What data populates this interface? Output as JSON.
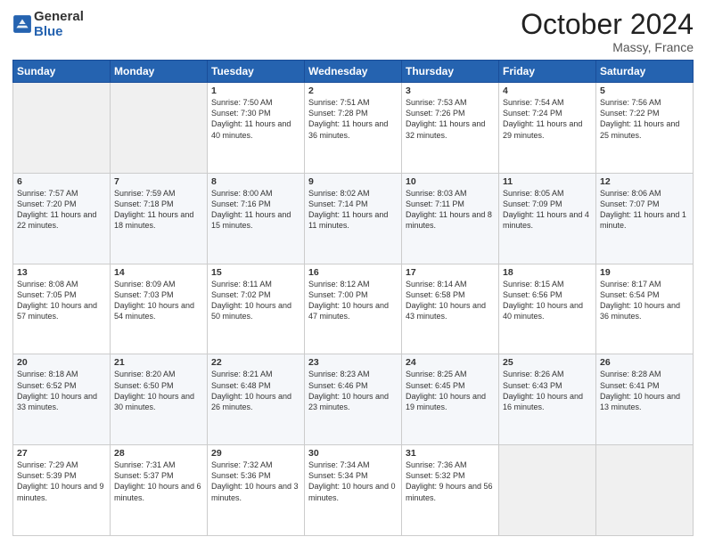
{
  "header": {
    "logo_line1": "General",
    "logo_line2": "Blue",
    "month": "October 2024",
    "location": "Massy, France"
  },
  "days_of_week": [
    "Sunday",
    "Monday",
    "Tuesday",
    "Wednesday",
    "Thursday",
    "Friday",
    "Saturday"
  ],
  "weeks": [
    [
      {
        "day": "",
        "sunrise": "",
        "sunset": "",
        "daylight": ""
      },
      {
        "day": "",
        "sunrise": "",
        "sunset": "",
        "daylight": ""
      },
      {
        "day": "1",
        "sunrise": "Sunrise: 7:50 AM",
        "sunset": "Sunset: 7:30 PM",
        "daylight": "Daylight: 11 hours and 40 minutes."
      },
      {
        "day": "2",
        "sunrise": "Sunrise: 7:51 AM",
        "sunset": "Sunset: 7:28 PM",
        "daylight": "Daylight: 11 hours and 36 minutes."
      },
      {
        "day": "3",
        "sunrise": "Sunrise: 7:53 AM",
        "sunset": "Sunset: 7:26 PM",
        "daylight": "Daylight: 11 hours and 32 minutes."
      },
      {
        "day": "4",
        "sunrise": "Sunrise: 7:54 AM",
        "sunset": "Sunset: 7:24 PM",
        "daylight": "Daylight: 11 hours and 29 minutes."
      },
      {
        "day": "5",
        "sunrise": "Sunrise: 7:56 AM",
        "sunset": "Sunset: 7:22 PM",
        "daylight": "Daylight: 11 hours and 25 minutes."
      }
    ],
    [
      {
        "day": "6",
        "sunrise": "Sunrise: 7:57 AM",
        "sunset": "Sunset: 7:20 PM",
        "daylight": "Daylight: 11 hours and 22 minutes."
      },
      {
        "day": "7",
        "sunrise": "Sunrise: 7:59 AM",
        "sunset": "Sunset: 7:18 PM",
        "daylight": "Daylight: 11 hours and 18 minutes."
      },
      {
        "day": "8",
        "sunrise": "Sunrise: 8:00 AM",
        "sunset": "Sunset: 7:16 PM",
        "daylight": "Daylight: 11 hours and 15 minutes."
      },
      {
        "day": "9",
        "sunrise": "Sunrise: 8:02 AM",
        "sunset": "Sunset: 7:14 PM",
        "daylight": "Daylight: 11 hours and 11 minutes."
      },
      {
        "day": "10",
        "sunrise": "Sunrise: 8:03 AM",
        "sunset": "Sunset: 7:11 PM",
        "daylight": "Daylight: 11 hours and 8 minutes."
      },
      {
        "day": "11",
        "sunrise": "Sunrise: 8:05 AM",
        "sunset": "Sunset: 7:09 PM",
        "daylight": "Daylight: 11 hours and 4 minutes."
      },
      {
        "day": "12",
        "sunrise": "Sunrise: 8:06 AM",
        "sunset": "Sunset: 7:07 PM",
        "daylight": "Daylight: 11 hours and 1 minute."
      }
    ],
    [
      {
        "day": "13",
        "sunrise": "Sunrise: 8:08 AM",
        "sunset": "Sunset: 7:05 PM",
        "daylight": "Daylight: 10 hours and 57 minutes."
      },
      {
        "day": "14",
        "sunrise": "Sunrise: 8:09 AM",
        "sunset": "Sunset: 7:03 PM",
        "daylight": "Daylight: 10 hours and 54 minutes."
      },
      {
        "day": "15",
        "sunrise": "Sunrise: 8:11 AM",
        "sunset": "Sunset: 7:02 PM",
        "daylight": "Daylight: 10 hours and 50 minutes."
      },
      {
        "day": "16",
        "sunrise": "Sunrise: 8:12 AM",
        "sunset": "Sunset: 7:00 PM",
        "daylight": "Daylight: 10 hours and 47 minutes."
      },
      {
        "day": "17",
        "sunrise": "Sunrise: 8:14 AM",
        "sunset": "Sunset: 6:58 PM",
        "daylight": "Daylight: 10 hours and 43 minutes."
      },
      {
        "day": "18",
        "sunrise": "Sunrise: 8:15 AM",
        "sunset": "Sunset: 6:56 PM",
        "daylight": "Daylight: 10 hours and 40 minutes."
      },
      {
        "day": "19",
        "sunrise": "Sunrise: 8:17 AM",
        "sunset": "Sunset: 6:54 PM",
        "daylight": "Daylight: 10 hours and 36 minutes."
      }
    ],
    [
      {
        "day": "20",
        "sunrise": "Sunrise: 8:18 AM",
        "sunset": "Sunset: 6:52 PM",
        "daylight": "Daylight: 10 hours and 33 minutes."
      },
      {
        "day": "21",
        "sunrise": "Sunrise: 8:20 AM",
        "sunset": "Sunset: 6:50 PM",
        "daylight": "Daylight: 10 hours and 30 minutes."
      },
      {
        "day": "22",
        "sunrise": "Sunrise: 8:21 AM",
        "sunset": "Sunset: 6:48 PM",
        "daylight": "Daylight: 10 hours and 26 minutes."
      },
      {
        "day": "23",
        "sunrise": "Sunrise: 8:23 AM",
        "sunset": "Sunset: 6:46 PM",
        "daylight": "Daylight: 10 hours and 23 minutes."
      },
      {
        "day": "24",
        "sunrise": "Sunrise: 8:25 AM",
        "sunset": "Sunset: 6:45 PM",
        "daylight": "Daylight: 10 hours and 19 minutes."
      },
      {
        "day": "25",
        "sunrise": "Sunrise: 8:26 AM",
        "sunset": "Sunset: 6:43 PM",
        "daylight": "Daylight: 10 hours and 16 minutes."
      },
      {
        "day": "26",
        "sunrise": "Sunrise: 8:28 AM",
        "sunset": "Sunset: 6:41 PM",
        "daylight": "Daylight: 10 hours and 13 minutes."
      }
    ],
    [
      {
        "day": "27",
        "sunrise": "Sunrise: 7:29 AM",
        "sunset": "Sunset: 5:39 PM",
        "daylight": "Daylight: 10 hours and 9 minutes."
      },
      {
        "day": "28",
        "sunrise": "Sunrise: 7:31 AM",
        "sunset": "Sunset: 5:37 PM",
        "daylight": "Daylight: 10 hours and 6 minutes."
      },
      {
        "day": "29",
        "sunrise": "Sunrise: 7:32 AM",
        "sunset": "Sunset: 5:36 PM",
        "daylight": "Daylight: 10 hours and 3 minutes."
      },
      {
        "day": "30",
        "sunrise": "Sunrise: 7:34 AM",
        "sunset": "Sunset: 5:34 PM",
        "daylight": "Daylight: 10 hours and 0 minutes."
      },
      {
        "day": "31",
        "sunrise": "Sunrise: 7:36 AM",
        "sunset": "Sunset: 5:32 PM",
        "daylight": "Daylight: 9 hours and 56 minutes."
      },
      {
        "day": "",
        "sunrise": "",
        "sunset": "",
        "daylight": ""
      },
      {
        "day": "",
        "sunrise": "",
        "sunset": "",
        "daylight": ""
      }
    ]
  ]
}
